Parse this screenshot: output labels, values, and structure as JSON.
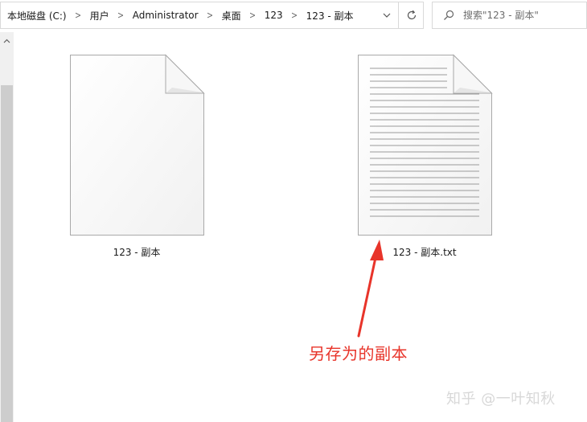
{
  "address_bar": {
    "breadcrumbs": [
      {
        "label": "本地磁盘 (C:)"
      },
      {
        "label": "用户"
      },
      {
        "label": "Administrator"
      },
      {
        "label": "桌面"
      },
      {
        "label": "123"
      },
      {
        "label": "123 - 副本"
      }
    ],
    "dropdown_icon": "chevron-down-icon",
    "refresh_icon": "refresh-icon"
  },
  "search": {
    "placeholder": "搜索\"123 - 副本\"",
    "icon": "search-icon"
  },
  "files": [
    {
      "name": "123 - 副本",
      "icon": "blank-file-icon"
    },
    {
      "name": "123 - 副本.txt",
      "icon": "text-file-icon"
    }
  ],
  "annotation": {
    "text": "另存为的副本",
    "color": "#e8342a"
  },
  "watermark": {
    "text": "知乎 @一叶知秋"
  }
}
